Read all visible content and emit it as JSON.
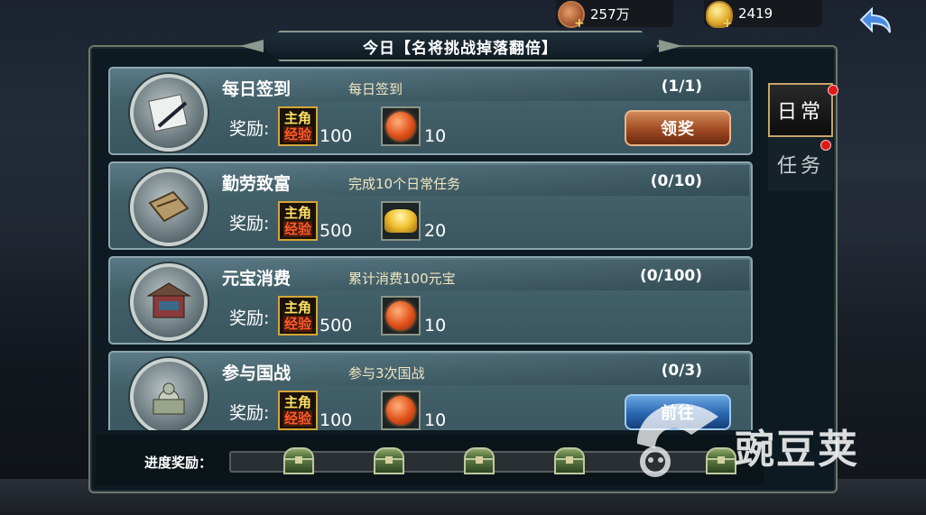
{
  "resources": {
    "copper": {
      "value": "257万",
      "icon": "copper-coin-icon"
    },
    "gold": {
      "value": "2419",
      "icon": "gold-ingot-icon"
    }
  },
  "title": "今日【名将挑战掉落翻倍】",
  "reward_label": "奖励:",
  "exp_badge": {
    "line1": "主角",
    "line2": "经验"
  },
  "tasks": [
    {
      "name": "每日签到",
      "desc": "每日签到",
      "progress": "(1/1)",
      "exp": "100",
      "item_icon": "orange-orb-icon",
      "item_qty": "10",
      "button": "领奖",
      "button_type": "claim"
    },
    {
      "name": "勤劳致富",
      "desc": "完成10个日常任务",
      "progress": "(0/10)",
      "exp": "500",
      "item_icon": "gold-ingot-icon",
      "item_qty": "20",
      "button": "",
      "button_type": "none"
    },
    {
      "name": "元宝消费",
      "desc": "累计消费100元宝",
      "progress": "(0/100)",
      "exp": "500",
      "item_icon": "orange-orb-icon",
      "item_qty": "10",
      "button": "",
      "button_type": "none"
    },
    {
      "name": "参与国战",
      "desc": "参与3次国战",
      "progress": "(0/3)",
      "exp": "100",
      "item_icon": "orange-orb-icon",
      "item_qty": "10",
      "button": "前往",
      "button_type": "go"
    }
  ],
  "tabs": [
    {
      "label": "日常",
      "active": true,
      "badge": true
    },
    {
      "label": "任务",
      "active": false,
      "badge": true
    }
  ],
  "progress_reward": {
    "label": "进度奖励：",
    "fill_fraction": 0.0,
    "chests": 5
  },
  "watermark": "豌豆荚",
  "colors": {
    "accent_gold": "#d4a53a",
    "claim_button": "#a04a22",
    "go_button": "#2a66b0",
    "badge_red": "#e01a1a"
  }
}
